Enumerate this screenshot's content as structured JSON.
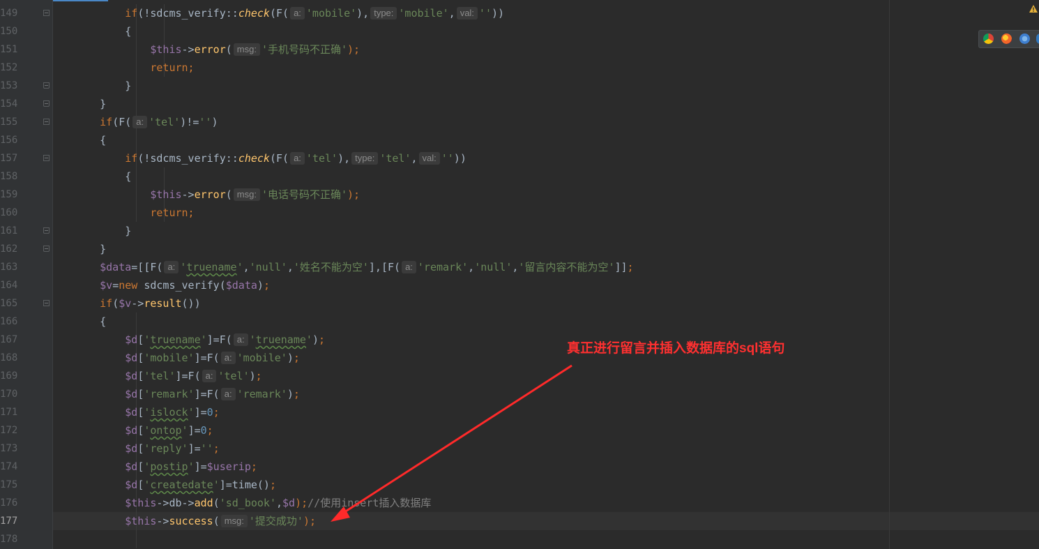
{
  "editor": {
    "lines": [
      {
        "num": "149",
        "code": [
          [
            "t",
            "        "
          ],
          [
            "kw",
            "if"
          ],
          [
            "t",
            "(!sdcms_verify::"
          ],
          [
            "fni",
            "check"
          ],
          [
            "t",
            "(F("
          ],
          [
            "hint",
            "a:"
          ],
          [
            "str",
            "'mobile'"
          ],
          [
            "t",
            "),"
          ],
          [
            "hint",
            "type:"
          ],
          [
            "str",
            "'mobile'"
          ],
          [
            "t",
            ","
          ],
          [
            "hint",
            "val:"
          ],
          [
            "str",
            "''"
          ],
          [
            "t",
            "))"
          ]
        ]
      },
      {
        "num": "150",
        "code": [
          [
            "t",
            "        {"
          ]
        ]
      },
      {
        "num": "151",
        "code": [
          [
            "t",
            "            "
          ],
          [
            "var",
            "$this"
          ],
          [
            "t",
            "->"
          ],
          [
            "fn",
            "error"
          ],
          [
            "t",
            "("
          ],
          [
            "hint",
            "msg:"
          ],
          [
            "str",
            "'手机号码不正确'"
          ],
          [
            "kw",
            ");"
          ]
        ]
      },
      {
        "num": "152",
        "code": [
          [
            "t",
            "            "
          ],
          [
            "kw",
            "return;"
          ]
        ]
      },
      {
        "num": "153",
        "code": [
          [
            "t",
            "        }"
          ]
        ]
      },
      {
        "num": "154",
        "code": [
          [
            "t",
            "    }"
          ]
        ]
      },
      {
        "num": "155",
        "code": [
          [
            "t",
            "    "
          ],
          [
            "kw",
            "if"
          ],
          [
            "t",
            "(F("
          ],
          [
            "hint",
            "a:"
          ],
          [
            "str",
            "'tel'"
          ],
          [
            "t",
            ")!="
          ],
          [
            "str",
            "''"
          ],
          [
            "t",
            ")"
          ]
        ]
      },
      {
        "num": "156",
        "code": [
          [
            "t",
            "    {"
          ]
        ]
      },
      {
        "num": "157",
        "code": [
          [
            "t",
            "        "
          ],
          [
            "kw",
            "if"
          ],
          [
            "t",
            "(!sdcms_verify::"
          ],
          [
            "fni",
            "check"
          ],
          [
            "t",
            "(F("
          ],
          [
            "hint",
            "a:"
          ],
          [
            "str",
            "'tel'"
          ],
          [
            "t",
            "),"
          ],
          [
            "hint",
            "type:"
          ],
          [
            "str",
            "'tel'"
          ],
          [
            "t",
            ","
          ],
          [
            "hint",
            "val:"
          ],
          [
            "str",
            "''"
          ],
          [
            "t",
            "))"
          ]
        ]
      },
      {
        "num": "158",
        "code": [
          [
            "t",
            "        {"
          ]
        ]
      },
      {
        "num": "159",
        "code": [
          [
            "t",
            "            "
          ],
          [
            "var",
            "$this"
          ],
          [
            "t",
            "->"
          ],
          [
            "fn",
            "error"
          ],
          [
            "t",
            "("
          ],
          [
            "hint",
            "msg:"
          ],
          [
            "str",
            "'电话号码不正确'"
          ],
          [
            "kw",
            ");"
          ]
        ]
      },
      {
        "num": "160",
        "code": [
          [
            "t",
            "            "
          ],
          [
            "kw",
            "return;"
          ]
        ]
      },
      {
        "num": "161",
        "code": [
          [
            "t",
            "        }"
          ]
        ]
      },
      {
        "num": "162",
        "code": [
          [
            "t",
            "    }"
          ]
        ]
      },
      {
        "num": "163",
        "code": [
          [
            "t",
            "    "
          ],
          [
            "var",
            "$data"
          ],
          [
            "t",
            "=[[F("
          ],
          [
            "hint",
            "a:"
          ],
          [
            "str",
            "'"
          ],
          [
            "strsq",
            "truename"
          ],
          [
            "str",
            "'"
          ],
          [
            "t",
            ","
          ],
          [
            "str",
            "'null'"
          ],
          [
            "t",
            ","
          ],
          [
            "str",
            "'姓名不能为空'"
          ],
          [
            "t",
            "],[F("
          ],
          [
            "hint",
            "a:"
          ],
          [
            "str",
            "'remark'"
          ],
          [
            "t",
            ","
          ],
          [
            "str",
            "'null'"
          ],
          [
            "t",
            ","
          ],
          [
            "str",
            "'留言内容不能为空'"
          ],
          [
            "t",
            "]]"
          ],
          [
            "kw",
            ";"
          ]
        ]
      },
      {
        "num": "164",
        "code": [
          [
            "t",
            "    "
          ],
          [
            "var",
            "$v"
          ],
          [
            "t",
            "="
          ],
          [
            "kw",
            "new "
          ],
          [
            "t",
            "sdcms_verify("
          ],
          [
            "var",
            "$data"
          ],
          [
            "t",
            ")"
          ],
          [
            "kw",
            ";"
          ]
        ]
      },
      {
        "num": "165",
        "code": [
          [
            "t",
            "    "
          ],
          [
            "kw",
            "if"
          ],
          [
            "t",
            "("
          ],
          [
            "var",
            "$v"
          ],
          [
            "t",
            "->"
          ],
          [
            "fn",
            "result"
          ],
          [
            "t",
            "())"
          ]
        ]
      },
      {
        "num": "166",
        "code": [
          [
            "t",
            "    {"
          ]
        ]
      },
      {
        "num": "167",
        "code": [
          [
            "t",
            "        "
          ],
          [
            "var",
            "$d"
          ],
          [
            "t",
            "["
          ],
          [
            "str",
            "'"
          ],
          [
            "strsq",
            "truename"
          ],
          [
            "str",
            "'"
          ],
          [
            "t",
            "]=F("
          ],
          [
            "hint",
            "a:"
          ],
          [
            "str",
            "'"
          ],
          [
            "strsq",
            "truename"
          ],
          [
            "str",
            "'"
          ],
          [
            "t",
            ")"
          ],
          [
            "kw",
            ";"
          ]
        ]
      },
      {
        "num": "168",
        "code": [
          [
            "t",
            "        "
          ],
          [
            "var",
            "$d"
          ],
          [
            "t",
            "["
          ],
          [
            "str",
            "'mobile'"
          ],
          [
            "t",
            "]=F("
          ],
          [
            "hint",
            "a:"
          ],
          [
            "str",
            "'mobile'"
          ],
          [
            "t",
            ")"
          ],
          [
            "kw",
            ";"
          ]
        ]
      },
      {
        "num": "169",
        "code": [
          [
            "t",
            "        "
          ],
          [
            "var",
            "$d"
          ],
          [
            "t",
            "["
          ],
          [
            "str",
            "'tel'"
          ],
          [
            "t",
            "]=F("
          ],
          [
            "hint",
            "a:"
          ],
          [
            "str",
            "'tel'"
          ],
          [
            "t",
            ")"
          ],
          [
            "kw",
            ";"
          ]
        ]
      },
      {
        "num": "170",
        "code": [
          [
            "t",
            "        "
          ],
          [
            "var",
            "$d"
          ],
          [
            "t",
            "["
          ],
          [
            "str",
            "'remark'"
          ],
          [
            "t",
            "]=F("
          ],
          [
            "hint",
            "a:"
          ],
          [
            "str",
            "'remark'"
          ],
          [
            "t",
            ")"
          ],
          [
            "kw",
            ";"
          ]
        ]
      },
      {
        "num": "171",
        "code": [
          [
            "t",
            "        "
          ],
          [
            "var",
            "$d"
          ],
          [
            "t",
            "["
          ],
          [
            "str",
            "'"
          ],
          [
            "strsq",
            "islock"
          ],
          [
            "str",
            "'"
          ],
          [
            "t",
            "]="
          ],
          [
            "num",
            "0"
          ],
          [
            "kw",
            ";"
          ]
        ]
      },
      {
        "num": "172",
        "code": [
          [
            "t",
            "        "
          ],
          [
            "var",
            "$d"
          ],
          [
            "t",
            "["
          ],
          [
            "str",
            "'"
          ],
          [
            "strsq",
            "ontop"
          ],
          [
            "str",
            "'"
          ],
          [
            "t",
            "]="
          ],
          [
            "num",
            "0"
          ],
          [
            "kw",
            ";"
          ]
        ]
      },
      {
        "num": "173",
        "code": [
          [
            "t",
            "        "
          ],
          [
            "var",
            "$d"
          ],
          [
            "t",
            "["
          ],
          [
            "str",
            "'reply'"
          ],
          [
            "t",
            "]="
          ],
          [
            "str",
            "''"
          ],
          [
            "kw",
            ";"
          ]
        ]
      },
      {
        "num": "174",
        "code": [
          [
            "t",
            "        "
          ],
          [
            "var",
            "$d"
          ],
          [
            "t",
            "["
          ],
          [
            "str",
            "'"
          ],
          [
            "strsq",
            "postip"
          ],
          [
            "str",
            "'"
          ],
          [
            "t",
            "]="
          ],
          [
            "var",
            "$userip"
          ],
          [
            "kw",
            ";"
          ]
        ]
      },
      {
        "num": "175",
        "code": [
          [
            "t",
            "        "
          ],
          [
            "var",
            "$d"
          ],
          [
            "t",
            "["
          ],
          [
            "str",
            "'"
          ],
          [
            "strsq",
            "createdate"
          ],
          [
            "str",
            "'"
          ],
          [
            "t",
            "]=time()"
          ],
          [
            "kw",
            ";"
          ]
        ]
      },
      {
        "num": "176",
        "code": [
          [
            "t",
            "        "
          ],
          [
            "var",
            "$this"
          ],
          [
            "t",
            "->db->"
          ],
          [
            "fn",
            "add"
          ],
          [
            "t",
            "("
          ],
          [
            "str",
            "'sd_book'"
          ],
          [
            "t",
            ","
          ],
          [
            "var",
            "$d"
          ],
          [
            "kw",
            ");"
          ],
          [
            "cmt",
            "//使用insert插入数据库"
          ]
        ]
      },
      {
        "num": "177",
        "code": [
          [
            "t",
            "        "
          ],
          [
            "var",
            "$this"
          ],
          [
            "t",
            "->"
          ],
          [
            "fn",
            "success"
          ],
          [
            "t",
            "("
          ],
          [
            "hint",
            "msg:"
          ],
          [
            "str",
            "'提交成功'"
          ],
          [
            "kw",
            ");"
          ]
        ]
      },
      {
        "num": "178",
        "code": [
          [
            "t",
            ""
          ]
        ]
      }
    ],
    "current_line": "177"
  },
  "annotation": {
    "text": "真正进行留言并插入数据库的sql语句",
    "color": "#ff3030"
  },
  "icons": {
    "warning": "warning-icon",
    "browsers": [
      "chrome-icon",
      "firefox-icon",
      "safari-icon",
      "edge-icon"
    ]
  },
  "colors": {
    "background": "#2b2b2b",
    "keyword": "#cc7832",
    "string": "#6a8759",
    "variable": "#9876aa",
    "function": "#ffc66d",
    "number": "#6897bb"
  }
}
